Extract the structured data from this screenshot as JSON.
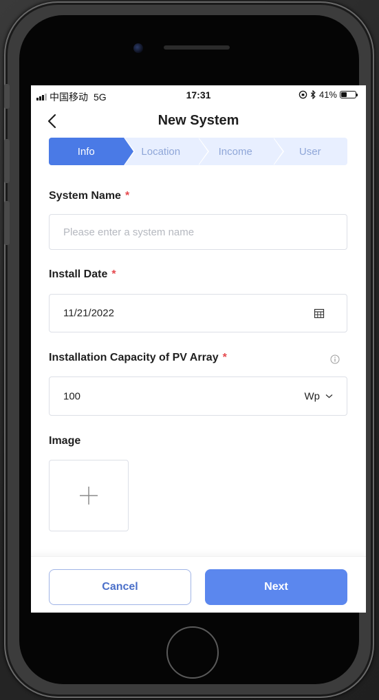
{
  "status_bar": {
    "carrier": "中国移动",
    "network": "5G",
    "time": "17:31",
    "battery": "41%",
    "battery_level": 0.41
  },
  "header": {
    "title": "New System",
    "back_icon": "chevron-left-icon"
  },
  "steps": [
    {
      "label": "Info",
      "active": true
    },
    {
      "label": "Location",
      "active": false
    },
    {
      "label": "Income",
      "active": false
    },
    {
      "label": "User",
      "active": false
    }
  ],
  "form": {
    "system_name": {
      "label": "System Name",
      "required_mark": "*",
      "placeholder": "Please enter a system name",
      "value": ""
    },
    "install_date": {
      "label": "Install Date",
      "required_mark": "*",
      "value": "11/21/2022",
      "icon": "calendar-icon"
    },
    "capacity": {
      "label": "Installation Capacity of PV Array",
      "required_mark": "*",
      "value": "100",
      "unit": "Wp",
      "info_icon": "info-icon"
    },
    "image": {
      "label": "Image",
      "upload_icon": "plus-icon"
    }
  },
  "footer": {
    "cancel_label": "Cancel",
    "next_label": "Next"
  },
  "colors": {
    "primary": "#4a7ae6",
    "button_primary": "#5b87ee",
    "step_inactive_bg": "#e8efff",
    "step_inactive_text": "#8fa6d8",
    "required": "#e5484d"
  }
}
